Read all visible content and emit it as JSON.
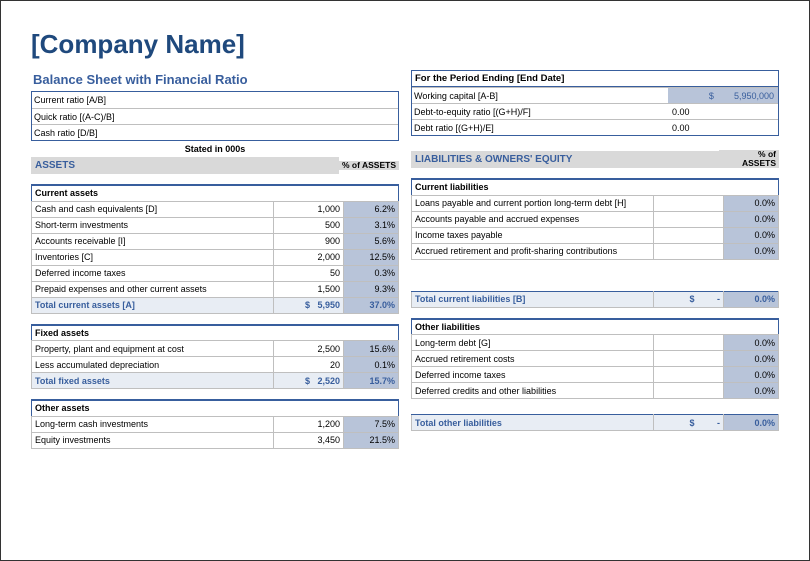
{
  "company_name": "[Company Name]",
  "subtitle": "Balance Sheet with Financial Ratio",
  "left_ratios": [
    {
      "label": "Current ratio  [A/B]",
      "value": ""
    },
    {
      "label": "Quick ratio  [(A-C)/B]",
      "value": ""
    },
    {
      "label": "Cash ratio  [D/B]",
      "value": ""
    }
  ],
  "period_heading": "For the Period Ending [End Date]",
  "right_ratios": [
    {
      "label": "Working capital  [A-B]",
      "value": "5,950,000",
      "currency": "$"
    },
    {
      "label": "Debt-to-equity ratio  [(G+H)/F]",
      "value": "0.00"
    },
    {
      "label": "Debt ratio  [(G+H)/E]",
      "value": "0.00"
    }
  ],
  "stated_in": "Stated in 000s",
  "assets_heading": "ASSETS",
  "liab_heading": "LIABILITIES & OWNERS' EQUITY",
  "pct_head": "% of ASSETS",
  "sections": {
    "current_assets": {
      "header": "Current assets",
      "rows": [
        {
          "name": "Cash and cash equivalents  [D]",
          "value": "1,000",
          "pct": "6.2%"
        },
        {
          "name": "Short-term investments",
          "value": "500",
          "pct": "3.1%"
        },
        {
          "name": "Accounts receivable  [I]",
          "value": "900",
          "pct": "5.6%"
        },
        {
          "name": "Inventories  [C]",
          "value": "2,000",
          "pct": "12.5%"
        },
        {
          "name": "Deferred income taxes",
          "value": "50",
          "pct": "0.3%"
        },
        {
          "name": "Prepaid expenses and other current assets",
          "value": "1,500",
          "pct": "9.3%"
        }
      ],
      "total": {
        "name": "Total current assets  [A]",
        "currency": "$",
        "value": "5,950",
        "pct": "37.0%"
      }
    },
    "fixed_assets": {
      "header": "Fixed assets",
      "rows": [
        {
          "name": "Property, plant and equipment at cost",
          "value": "2,500",
          "pct": "15.6%"
        },
        {
          "name": "Less accumulated depreciation",
          "value": "20",
          "pct": "0.1%"
        }
      ],
      "total": {
        "name": "Total fixed assets",
        "currency": "$",
        "value": "2,520",
        "pct": "15.7%"
      }
    },
    "other_assets": {
      "header": "Other assets",
      "rows": [
        {
          "name": "Long-term cash investments",
          "value": "1,200",
          "pct": "7.5%"
        },
        {
          "name": "Equity investments",
          "value": "3,450",
          "pct": "21.5%"
        }
      ]
    },
    "current_liabilities": {
      "header": "Current liabilities",
      "rows": [
        {
          "name": "Loans payable and current portion long-term debt  [H]",
          "value": "",
          "pct": "0.0%"
        },
        {
          "name": "Accounts payable and accrued expenses",
          "value": "",
          "pct": "0.0%"
        },
        {
          "name": "Income taxes payable",
          "value": "",
          "pct": "0.0%"
        },
        {
          "name": "Accrued retirement and profit-sharing contributions",
          "value": "",
          "pct": "0.0%"
        }
      ],
      "total": {
        "name": "Total current liabilities  [B]",
        "currency": "$",
        "value": "-",
        "pct": "0.0%"
      }
    },
    "other_liabilities": {
      "header": "Other liabilities",
      "rows": [
        {
          "name": "Long-term debt  [G]",
          "value": "",
          "pct": "0.0%"
        },
        {
          "name": "Accrued retirement costs",
          "value": "",
          "pct": "0.0%"
        },
        {
          "name": "Deferred income taxes",
          "value": "",
          "pct": "0.0%"
        },
        {
          "name": "Deferred credits and other liabilities",
          "value": "",
          "pct": "0.0%"
        }
      ],
      "total": {
        "name": "Total other liabilities",
        "currency": "$",
        "value": "-",
        "pct": "0.0%"
      }
    }
  }
}
